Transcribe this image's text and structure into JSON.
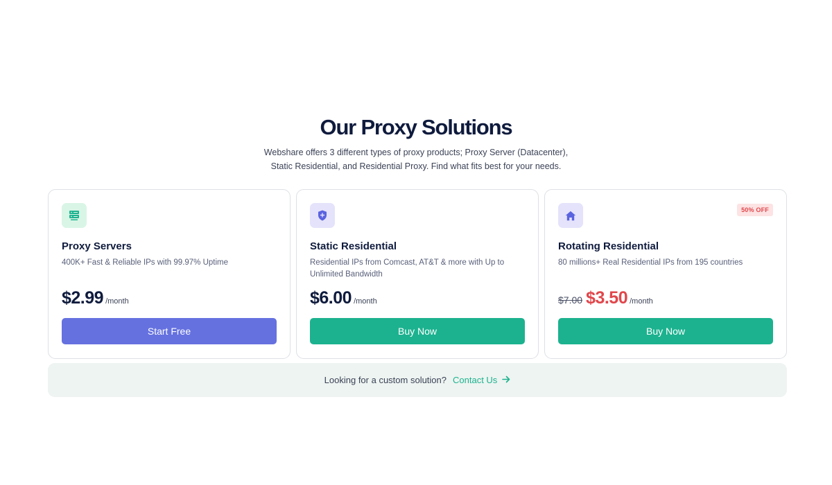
{
  "section": {
    "title": "Our Proxy Solutions",
    "subtitle": "Webshare offers 3 different types of proxy products; Proxy Server (Datacenter), Static Residential, and Residential Proxy. Find what fits best for your needs."
  },
  "cards": [
    {
      "icon": "server-icon",
      "title": "Proxy Servers",
      "description": "400K+ Fast & Reliable IPs with 99.97% Uptime",
      "price": "$2.99",
      "period": "/month",
      "button": "Start Free"
    },
    {
      "icon": "shield-icon",
      "title": "Static Residential",
      "description": "Residential IPs from Comcast, AT&T & more with Up to Unlimited Bandwidth",
      "price": "$6.00",
      "period": "/month",
      "button": "Buy Now"
    },
    {
      "icon": "home-icon",
      "badge": "50% OFF",
      "title": "Rotating Residential",
      "description": "80 millions+ Real Residential IPs from 195 countries",
      "old_price": "$7.00",
      "price": "$3.50",
      "period": "/month",
      "button": "Buy Now"
    }
  ],
  "custom": {
    "text": "Looking for a custom solution?",
    "link": "Contact Us",
    "link_icon": "arrow-right-icon"
  },
  "colors": {
    "heading": "#0f1b3d",
    "start_free_button": "#6571df",
    "buy_now_button": "#1cb28f",
    "sale_price": "#e0474c",
    "contact_link": "#1cb28f"
  }
}
